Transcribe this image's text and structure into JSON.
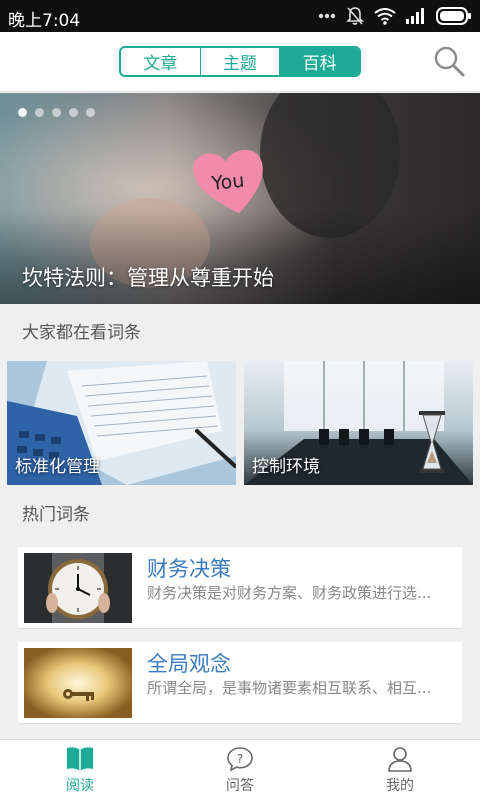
{
  "status": {
    "time": "晚上7:04",
    "icons": [
      "dots-icon",
      "mute-icon",
      "wifi-icon",
      "signal-icon",
      "battery-icon"
    ]
  },
  "header": {
    "tabs": [
      {
        "label": "文章",
        "active": false
      },
      {
        "label": "主题",
        "active": false
      },
      {
        "label": "百科",
        "active": true
      }
    ],
    "search_icon": "search-icon"
  },
  "banner": {
    "title": "坎特法则：管理从尊重开始",
    "note_text": "You",
    "dots": 5,
    "active_dot": 0
  },
  "section_popular": {
    "title": "大家都在看词条",
    "cards": [
      {
        "label": "标准化管理"
      },
      {
        "label": "控制环境"
      }
    ]
  },
  "section_hot": {
    "title": "热门词条",
    "items": [
      {
        "title": "财务决策",
        "desc": "财务决策是对财务方案、财务政策进行选..."
      },
      {
        "title": "全局观念",
        "desc": "所谓全局，是事物诸要素相互联系、相互..."
      }
    ]
  },
  "tabbar": {
    "tabs": [
      {
        "label": "阅读",
        "icon": "book-icon",
        "active": true
      },
      {
        "label": "问答",
        "icon": "question-bubble-icon",
        "active": false
      },
      {
        "label": "我的",
        "icon": "user-icon",
        "active": false
      }
    ]
  },
  "colors": {
    "accent": "#1daa96",
    "link_title": "#3a7bbf"
  }
}
